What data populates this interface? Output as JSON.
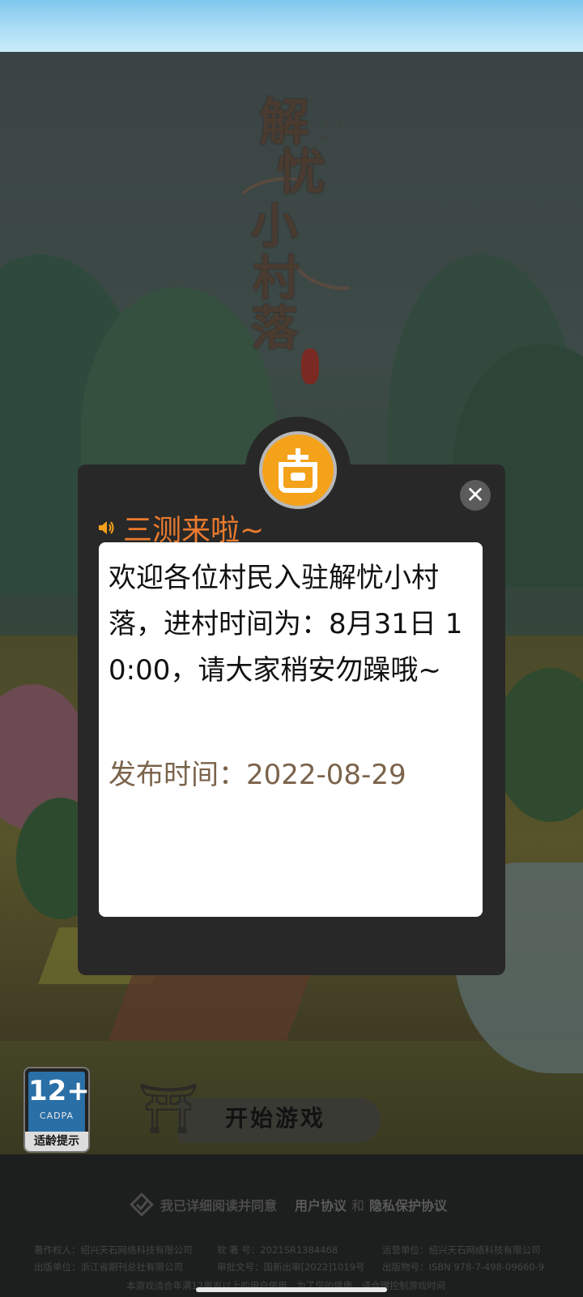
{
  "logo": {
    "chars": [
      "解",
      "忧",
      "小",
      "村",
      "落"
    ]
  },
  "announcement": {
    "title": "三测来啦~",
    "message": "欢迎各位村民入驻解忧小村落，进村时间为：8月31日 10:00，请大家稍安勿躁哦~",
    "publish_label": "发布时间：",
    "publish_date": "2022-08-29",
    "close_icon": "close-icon"
  },
  "age_rating": {
    "number": "12+",
    "org": "CADPA",
    "label": "适龄提示"
  },
  "start_button": {
    "label": "开始游戏"
  },
  "agreement": {
    "text": "我已详细阅读并同意",
    "user_agreement": "用户协议",
    "and": "和",
    "privacy_agreement": "隐私保护协议"
  },
  "footer": {
    "copyright_owner": "著作权人：绍兴天石网络科技有限公司",
    "software_no": "软 著 号：2021SR1384468",
    "operator": "运营单位：绍兴天石网络科技有限公司",
    "publisher": "出版单位：浙江省期刊总社有限公司",
    "approval_no": "审批文号：国新出审[2022]1019号",
    "isbn": "出版物号：ISBN 978-7-498-09660-9",
    "notice": "本游戏适合年满12周岁以上的用户使用，为了您的健康，请合理控制游戏时间"
  },
  "colors": {
    "title_orange": "#ec7b2d",
    "badge_orange": "#f4a21a",
    "publish_brown": "#7b634b",
    "modal_bg": "#282828"
  }
}
